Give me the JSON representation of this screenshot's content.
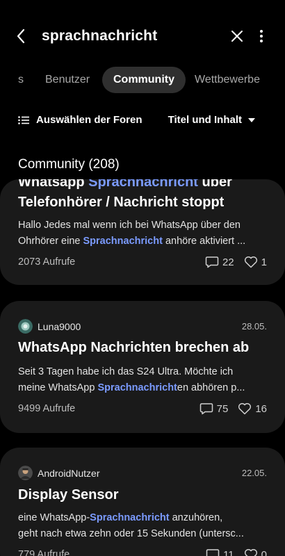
{
  "search": {
    "query": "sprachnachricht"
  },
  "tabs": [
    {
      "label": "s"
    },
    {
      "label": "Benutzer"
    },
    {
      "label": "Community"
    },
    {
      "label": "Wettbewerbe"
    }
  ],
  "filters": {
    "forum_select_label": "Auswählen der Foren",
    "scope_label": "Titel und Inhalt"
  },
  "section": {
    "title": "Community (208)"
  },
  "posts": [
    {
      "title_line1": "Whatsapp Sprachnachricht über",
      "title_line2": "Telefonhörer / Nachricht stoppt",
      "excerpt_line1": "Hallo Jedes mal wenn ich bei WhatsApp über den",
      "excerpt_line2_pre": "Ohrhörer eine ",
      "excerpt_line2_hl": "Sprachnachricht",
      "excerpt_line2_post": " anhöre aktiviert ...",
      "views": "2073 Aufrufe",
      "comments": "22",
      "likes": "1"
    },
    {
      "author": "Luna9000",
      "date": "28.05.",
      "title": "WhatsApp Nachrichten brechen ab",
      "excerpt_line1": "Seit 3 Tagen habe ich das S24 Ultra. Möchte ich",
      "excerpt_line2_pre": "meine WhatsApp ",
      "excerpt_line2_hl": "Sprachnachricht",
      "excerpt_line2_post": "en abhören p...",
      "views": "9499 Aufrufe",
      "comments": "75",
      "likes": "16"
    },
    {
      "author": "AndroidNutzer",
      "date": "22.05.",
      "title": "Display Sensor",
      "excerpt_line1_pre": "eine WhatsApp-",
      "excerpt_line1_hl": "Sprachnachricht",
      "excerpt_line1_post": " anzuhören,",
      "excerpt_line2": "geht nach etwa zehn oder 15 Sekunden (untersc...",
      "views": "779 Aufrufe",
      "comments": "11",
      "likes": "0"
    }
  ],
  "colors": {
    "background": "#000000",
    "card": "#1a1a1a",
    "highlight": "#7b9bff",
    "active_tab": "#2f2f2f"
  },
  "icons": [
    "back-arrow-icon",
    "close-icon",
    "more-vert-icon",
    "list-icon",
    "caret-down-icon",
    "comment-icon",
    "heart-icon"
  ]
}
